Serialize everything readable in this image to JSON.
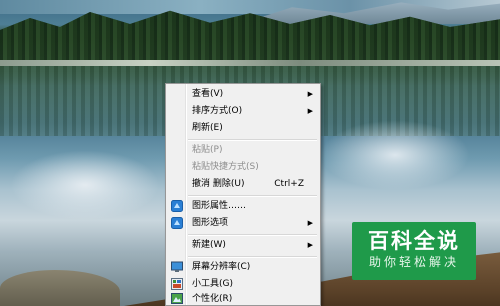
{
  "context_menu": {
    "items": [
      {
        "label": "查看(V)",
        "shortcut": "",
        "submenu": true,
        "disabled": false
      },
      {
        "label": "排序方式(O)",
        "shortcut": "",
        "submenu": true,
        "disabled": false
      },
      {
        "label": "刷新(E)",
        "shortcut": "",
        "submenu": false,
        "disabled": false
      },
      {
        "label": "粘贴(P)",
        "shortcut": "",
        "submenu": false,
        "disabled": true
      },
      {
        "label": "粘贴快捷方式(S)",
        "shortcut": "",
        "submenu": false,
        "disabled": true
      },
      {
        "label": "撤消 删除(U)",
        "shortcut": "Ctrl+Z",
        "submenu": false,
        "disabled": false
      },
      {
        "label": "图形属性……",
        "shortcut": "",
        "submenu": false,
        "disabled": false,
        "icon": "intel-graphics-icon"
      },
      {
        "label": "图形选项",
        "shortcut": "",
        "submenu": true,
        "disabled": false,
        "icon": "intel-graphics-icon"
      },
      {
        "label": "新建(W)",
        "shortcut": "",
        "submenu": true,
        "disabled": false
      },
      {
        "label": "屏幕分辨率(C)",
        "shortcut": "",
        "submenu": false,
        "disabled": false,
        "icon": "monitor-icon"
      },
      {
        "label": "小工具(G)",
        "shortcut": "",
        "submenu": false,
        "disabled": false,
        "icon": "gadgets-icon"
      },
      {
        "label": "个性化(R)",
        "shortcut": "",
        "submenu": false,
        "disabled": false,
        "icon": "personalize-icon"
      }
    ]
  },
  "watermark": {
    "title": "百科全说",
    "subtitle": "助你轻松解决"
  },
  "colors": {
    "menu_background": "#f0f0f0",
    "disabled_text": "#8d8d8d",
    "watermark_green": "#1f9a4a"
  }
}
